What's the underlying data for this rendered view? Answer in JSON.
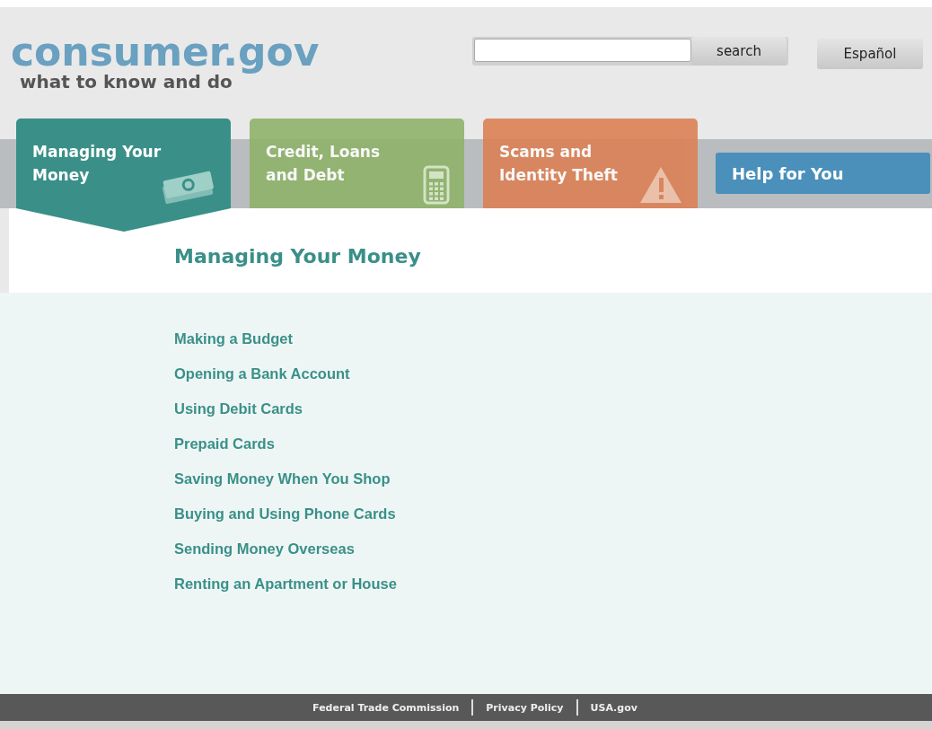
{
  "logo": {
    "title": "consumer.gov",
    "tagline": "what to know and do"
  },
  "search": {
    "button": "search"
  },
  "language_button": "Español",
  "tabs": [
    {
      "label": "Managing Your Money",
      "kind": "money",
      "selected": true
    },
    {
      "label": "Credit, Loans and Debt",
      "kind": "calculator",
      "selected": false
    },
    {
      "label": "Scams and Identity Theft",
      "kind": "warning",
      "selected": false
    }
  ],
  "help_button": "Help for You",
  "section": {
    "title": "Managing Your Money",
    "links": [
      "Making a Budget",
      "Opening a Bank Account",
      "Using Debit Cards",
      "Prepaid Cards",
      "Saving Money When You Shop",
      "Buying and Using Phone Cards",
      "Sending Money Overseas",
      "Renting an Apartment or House"
    ]
  },
  "footer": {
    "links": [
      "Federal Trade Commission",
      "Privacy Policy",
      "USA.gov"
    ]
  }
}
